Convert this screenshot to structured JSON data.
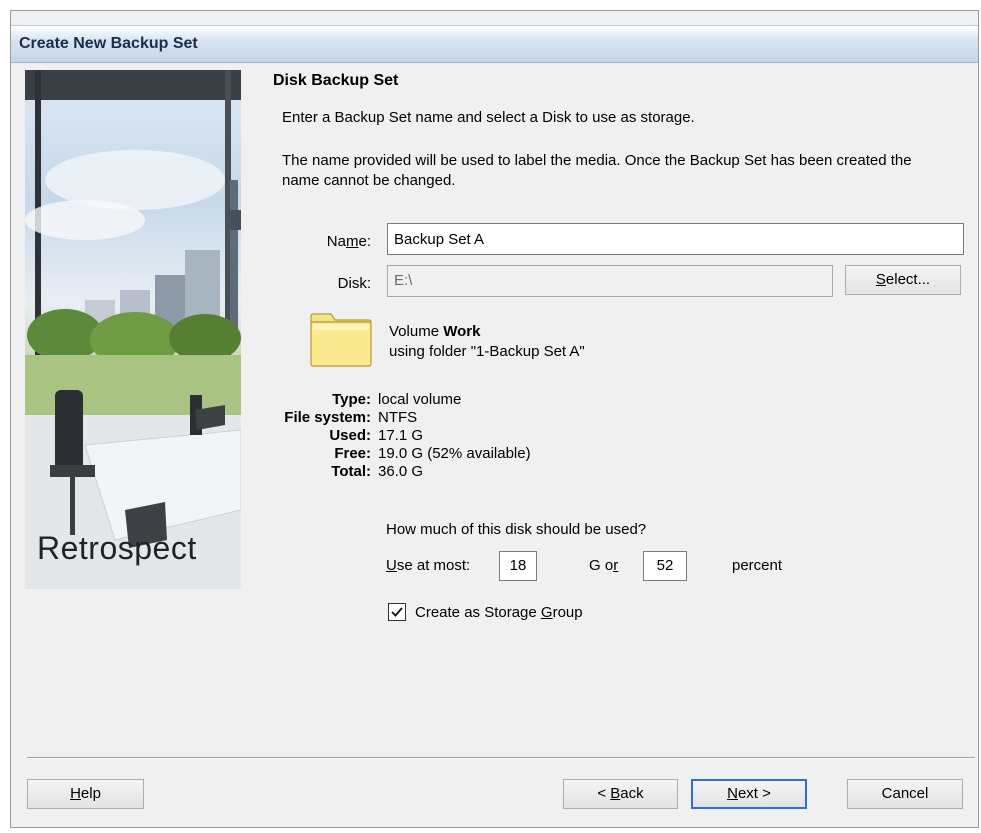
{
  "window": {
    "title": "Create New Backup Set"
  },
  "brand": "Retrospect",
  "heading": "Disk Backup Set",
  "intro": "Enter a Backup Set name and select a Disk to use as storage.",
  "paragraph": "The name provided will be used to label the media. Once the Backup Set has been created the name cannot be changed.",
  "form": {
    "name_label": "Name:",
    "name_value": "Backup Set A",
    "disk_label": "Disk:",
    "disk_value": "E:\\",
    "select_button": "Select..."
  },
  "volume": {
    "prefix": "Volume",
    "name": "Work",
    "folder_line": "using folder \"1-Backup Set A\""
  },
  "info": [
    {
      "key": "Type:",
      "value": "local volume"
    },
    {
      "key": "File system:",
      "value": "NTFS"
    },
    {
      "key": "Used:",
      "value": "17.1 G"
    },
    {
      "key": "Free:",
      "value": "19.0 G (52% available)"
    },
    {
      "key": "Total:",
      "value": "36.0 G"
    }
  ],
  "usage": {
    "question": "How much of this disk should be used?",
    "use_at_most_label": "Use at most:",
    "gb_value": "18",
    "g_or_label": "G or",
    "percent_value": "52",
    "percent_label": "percent"
  },
  "storage_group": {
    "label": "Create as Storage Group",
    "checked": true
  },
  "buttons": {
    "help": "Help",
    "back": "< Back",
    "next": "Next >",
    "cancel": "Cancel"
  },
  "icons": {
    "folder": "folder-icon",
    "checkmark": "checkmark-icon"
  }
}
